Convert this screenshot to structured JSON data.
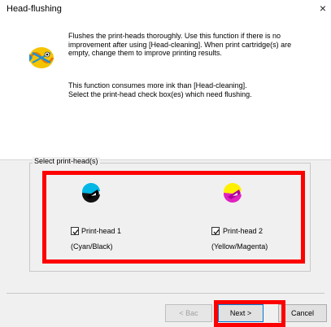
{
  "window": {
    "title": "Head-flushing",
    "close_glyph": "×"
  },
  "description": {
    "paragraph1": [
      "Flushes the print-heads thoroughly. Use this function if there is no",
      "improvement after using [Head-cleaning]. When print cartridge(s) are",
      "empty, change them to improve printing results."
    ],
    "paragraph2": [
      "This function consumes more ink than [Head-cleaning].",
      "Select the print-head check box(es) which need flushing."
    ]
  },
  "group": {
    "label": "Select print-head(s)",
    "heads": [
      {
        "label": "Print-head 1",
        "colors": "(Cyan/Black)",
        "checked": true,
        "ink_a": "#00b7e6",
        "ink_b": "#111111"
      },
      {
        "label": "Print-head 2",
        "colors": "(Yellow/Magenta)",
        "checked": true,
        "ink_a": "#ffef00",
        "ink_b": "#e020c0"
      }
    ]
  },
  "buttons": {
    "back": "< Bac",
    "next": "Next >",
    "cancel": "Cancel"
  },
  "colors": {
    "highlight": "#ff0000",
    "accent": "#0078d7"
  }
}
